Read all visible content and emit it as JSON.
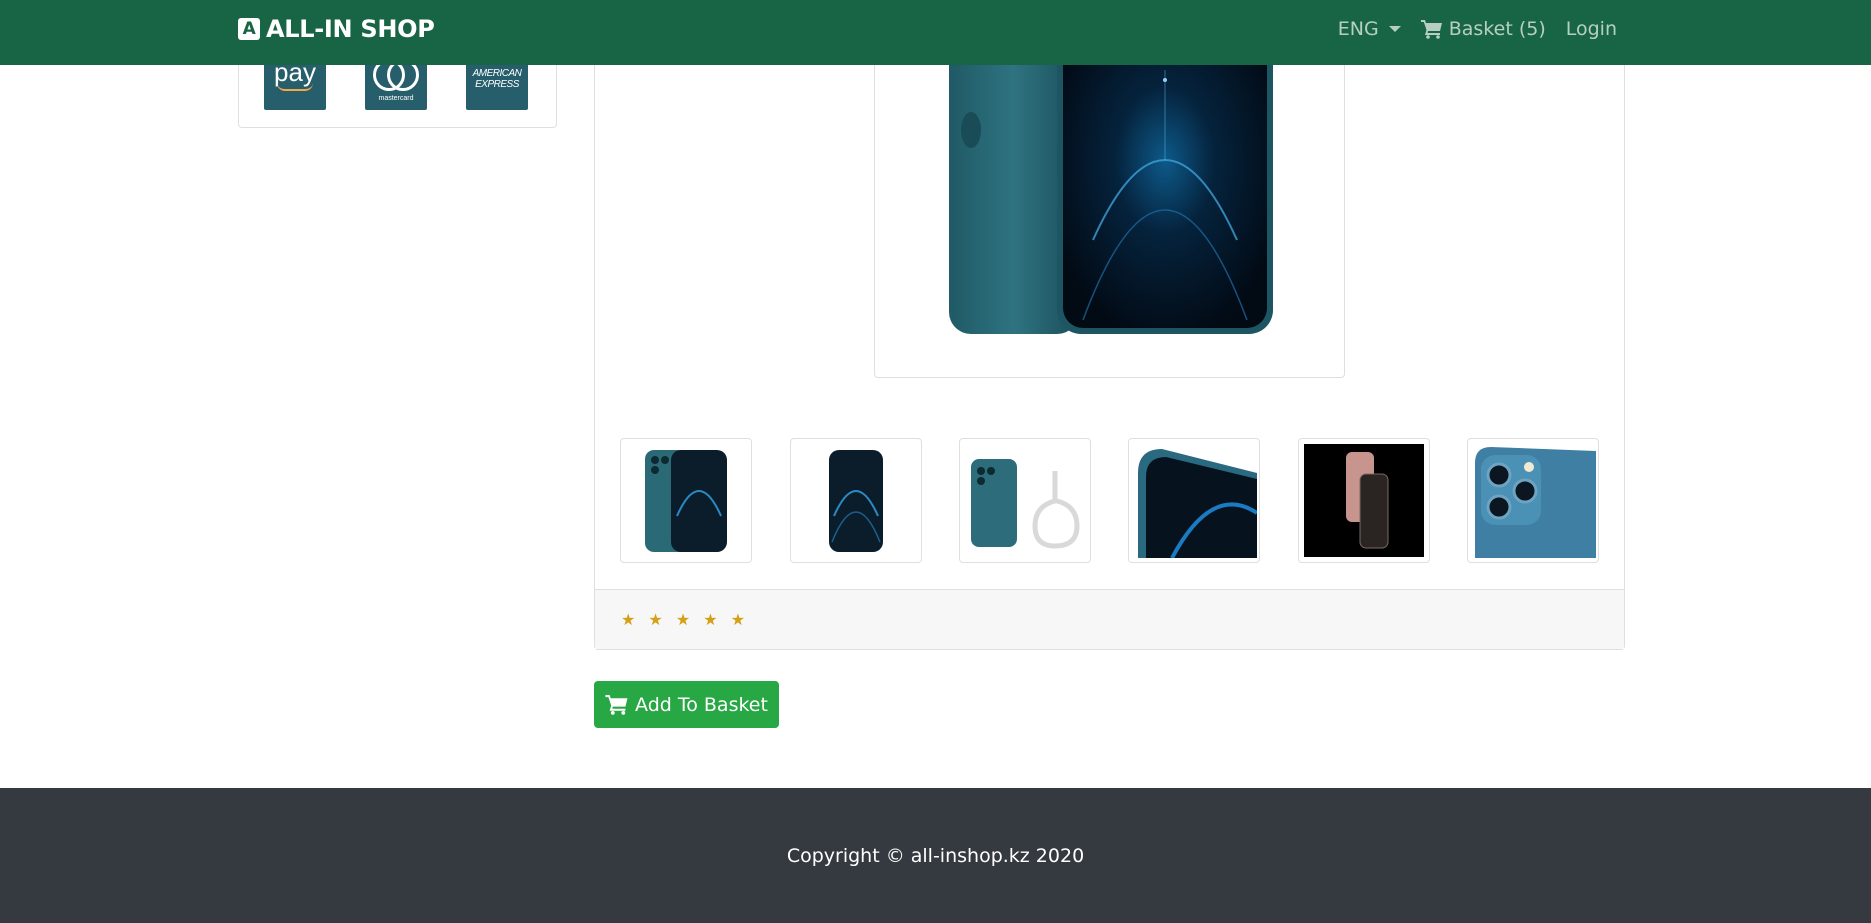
{
  "navbar": {
    "brand": "ALL-IN SHOP",
    "brand_logo_letter": "A",
    "language": "ENG",
    "basket": "Basket (5)",
    "login": "Login"
  },
  "payment": {
    "amazon_pay": "pay",
    "mastercard": "mastercard",
    "amex_line1": "AMERICAN",
    "amex_line2": "EXPRESS"
  },
  "product": {
    "rating_stars": "★ ★ ★ ★ ★",
    "rating": 5,
    "thumbnails": [
      "phone-front-back-icon",
      "phone-front-icon",
      "phone-with-cable-icon",
      "phone-edge-closeup-icon",
      "phone-pair-dark-icon",
      "camera-closeup-icon"
    ]
  },
  "actions": {
    "add_to_basket": "Add To Basket"
  },
  "footer": {
    "copyright": "Copyright © all-inshop.kz 2020"
  },
  "colors": {
    "navbar": "#186545",
    "button": "#28a745",
    "footer": "#343a40",
    "stars": "#d4a017"
  }
}
